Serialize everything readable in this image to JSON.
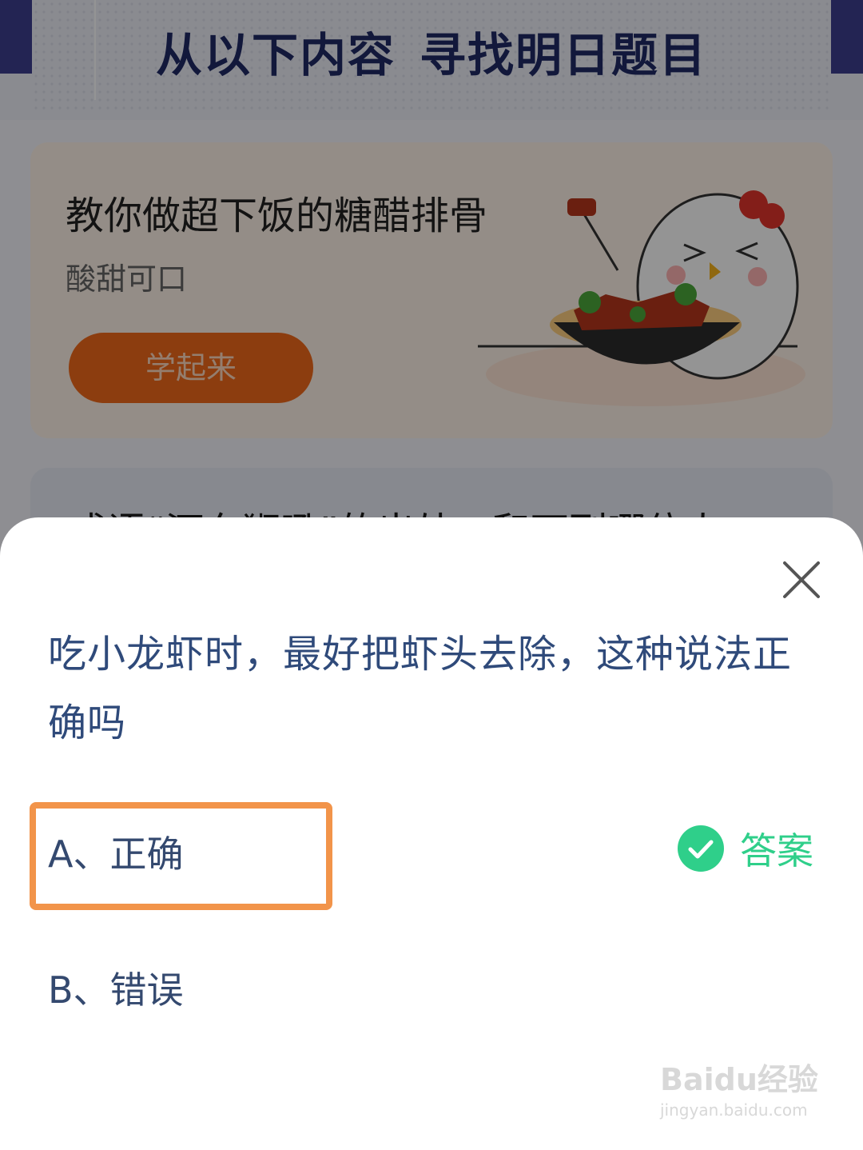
{
  "background": {
    "heading": [
      "从以下内容",
      "寻找明日题目"
    ],
    "recipe_card": {
      "title": "教你做超下饭的糖醋排骨",
      "subtitle": "酸甜可口",
      "button_label": "学起来"
    },
    "next_card_peek": "成语“河东狮吼”的出处，和下列哪位人"
  },
  "quiz": {
    "question": "吃小龙虾时，最好把虾头去除，这种说法正确吗",
    "options": [
      {
        "label": "A、正确",
        "is_answer": true
      },
      {
        "label": "B、错误",
        "is_answer": false
      }
    ],
    "answer_label": "答案"
  },
  "watermark": {
    "brand": "Baidu经验",
    "url": "jingyan.baidu.com"
  },
  "colors": {
    "question_text": "#2f4a7a",
    "answer_green": "#2fcf8a",
    "highlight_orange": "#f2944a",
    "recipe_button": "#f26a1b",
    "header_band": "#3d3f8f"
  },
  "icons": {
    "close": "close-icon",
    "answer": "check-circle-icon"
  }
}
